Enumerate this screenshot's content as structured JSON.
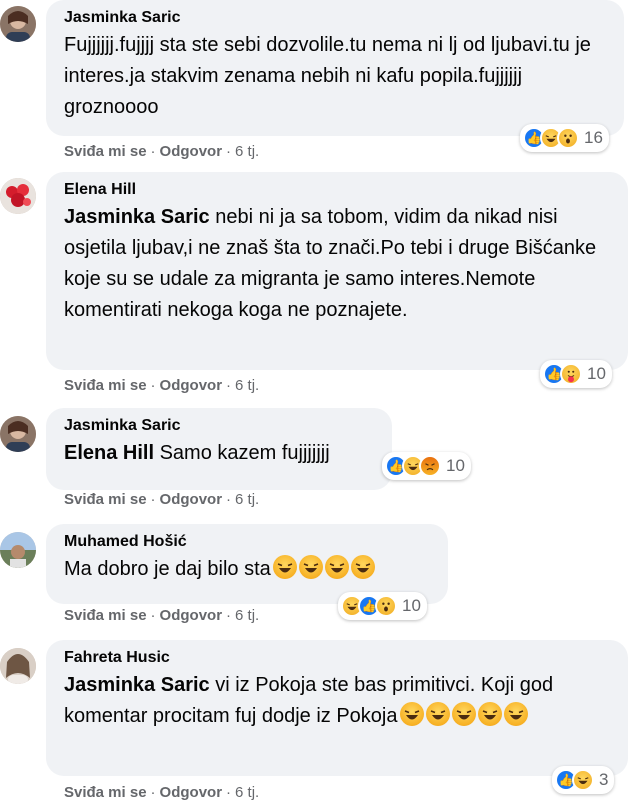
{
  "comments": [
    {
      "author": "Jasminka Saric",
      "mention": "",
      "text": "Fujjjjjj.fujjjj sta ste sebi dozvolile.tu nema ni lj od ljubavi.tu je interes.ja stakvim zenama nebih ni kafu popila.fujjjjjj groznoooo",
      "reaction_count": "16",
      "reactions": [
        "like-icon",
        "haha-icon",
        "wow-icon"
      ],
      "actions": {
        "like": "Sviđa mi se",
        "reply": "Odgovor",
        "time": "6 tj."
      }
    },
    {
      "author": "Elena Hill",
      "mention": "Jasminka Saric",
      "text": "nebi ni ja sa tobom, vidim da nikad nisi osjetila ljubav,i ne znaš šta to znači.Po tebi i druge Bišćanke koje su se udale za migranta je samo interes.Nemote komentirati nekoga koga ne poznajete.",
      "reaction_count": "10",
      "reactions": [
        "like-icon",
        "care-icon"
      ],
      "actions": {
        "like": "Sviđa mi se",
        "reply": "Odgovor",
        "time": "6 tj."
      }
    },
    {
      "author": "Jasminka Saric",
      "mention": "Elena Hill",
      "text": "Samo kazem fujjjjjjj",
      "reaction_count": "10",
      "reactions": [
        "like-icon",
        "haha-icon",
        "angry-icon"
      ],
      "actions": {
        "like": "Sviđa mi se",
        "reply": "Odgovor",
        "time": "6 tj."
      }
    },
    {
      "author": "Muhamed Hošić",
      "mention": "",
      "text": "Ma dobro je daj bilo sta",
      "trailing_emoji": [
        "laugh-emoji",
        "laugh-emoji",
        "laugh-emoji",
        "laugh-emoji"
      ],
      "reaction_count": "10",
      "reactions": [
        "haha-icon",
        "like-icon",
        "wow-icon"
      ],
      "actions": {
        "like": "Sviđa mi se",
        "reply": "Odgovor",
        "time": "6 tj."
      }
    },
    {
      "author": "Fahreta Husic",
      "mention": "Jasminka Saric",
      "text": "vi iz Pokoja ste bas primitivci. Koji god komentar procitam fuj dodje iz Pokoja",
      "trailing_emoji": [
        "laugh-emoji",
        "laugh-emoji",
        "laugh-emoji",
        "laugh-emoji",
        "laugh-emoji"
      ],
      "reaction_count": "3",
      "reactions": [
        "like-icon",
        "haha-icon"
      ],
      "actions": {
        "like": "Sviđa mi se",
        "reply": "Odgovor",
        "time": "6 tj."
      }
    }
  ]
}
